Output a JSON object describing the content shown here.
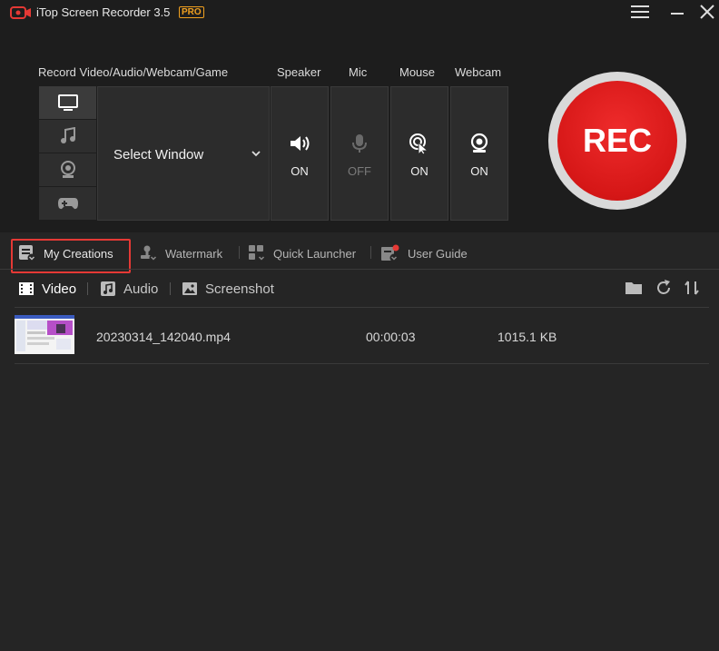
{
  "app": {
    "title": "iTop Screen Recorder 3.5",
    "badge": "PRO"
  },
  "window_controls": [
    "menu-icon",
    "minimize-icon",
    "close-icon"
  ],
  "record": {
    "section_label": "Record Video/Audio/Webcam/Game",
    "sources": [
      "screen-icon",
      "music-icon",
      "webcam-icon",
      "gamepad-icon"
    ],
    "active_source": "screen-icon",
    "select_window_label": "Select Window"
  },
  "devices": [
    {
      "label": "Speaker",
      "state": "ON",
      "icon": "speaker-icon"
    },
    {
      "label": "Mic",
      "state": "OFF",
      "icon": "mic-icon"
    },
    {
      "label": "Mouse",
      "state": "ON",
      "icon": "mouse-click-icon"
    },
    {
      "label": "Webcam",
      "state": "ON",
      "icon": "webcam-icon"
    }
  ],
  "rec_button": {
    "label": "REC",
    "color": "#e02020"
  },
  "tabs": [
    {
      "label": "My Creations",
      "active": true
    },
    {
      "label": "Watermark"
    },
    {
      "label": "Quick Launcher"
    },
    {
      "label": "User Guide"
    }
  ],
  "subtabs": [
    {
      "label": "Video",
      "active": true
    },
    {
      "label": "Audio"
    },
    {
      "label": "Screenshot"
    }
  ],
  "toolbar_icons": [
    "folder-icon",
    "refresh-icon",
    "sort-icon"
  ],
  "files": [
    {
      "name": "20230314_142040.mp4",
      "duration": "00:00:03",
      "size": "1015.1 KB"
    }
  ],
  "colors": {
    "accent": "#e53935",
    "badge": "#f0a020",
    "background": "#252525"
  }
}
